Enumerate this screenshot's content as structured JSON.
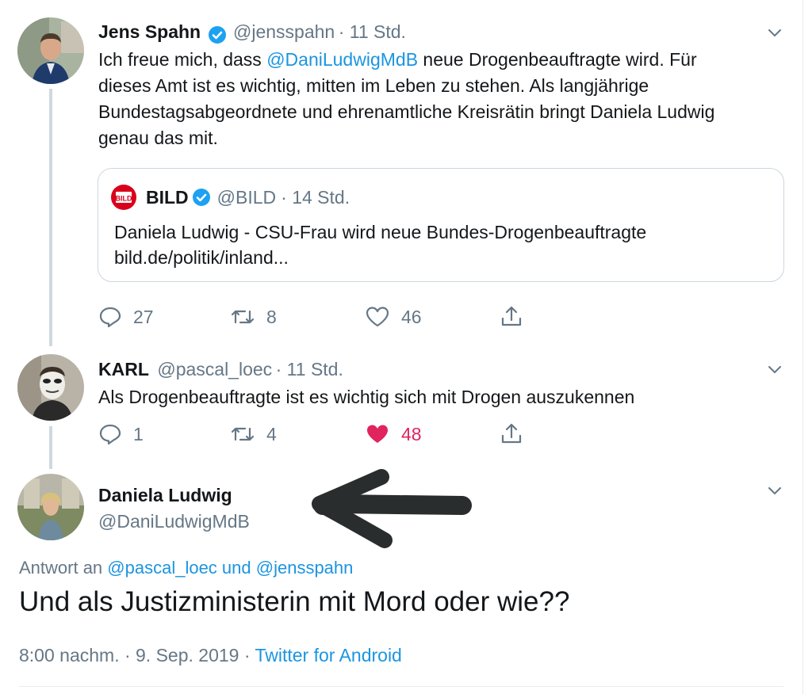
{
  "tweet1": {
    "name": "Jens Spahn",
    "handle": "@jensspahn",
    "time": "· 11 Std.",
    "text_lines": [
      [
        "Ich freue mich, dass ",
        "@DaniLudwigMdB",
        " neue Drogenbeauftragte wird. Für"
      ],
      "dieses Amt ist es wichtig, mitten im Leben zu stehen. Als langjährige",
      "Bundestagsabgeordnete und ehrenamtliche Kreisrätin bringt Daniela Ludwig",
      "genau das mit."
    ],
    "quote": {
      "logo": "BILD",
      "name": "BILD",
      "handle": "@BILD",
      "time": "· 14 Std.",
      "text": "Daniela Ludwig - CSU-Frau wird neue Bundes-Drogenbeauftragte",
      "link": "bild.de/politik/inland..."
    },
    "actions": {
      "replies": "27",
      "retweets": "8",
      "likes": "46"
    }
  },
  "tweet2": {
    "name": "KARL",
    "handle": "@pascal_loec",
    "time": "· 11 Std.",
    "text": "Als Drogenbeauftragte ist es wichtig sich mit Drogen auszukennen",
    "actions": {
      "replies": "1",
      "retweets": "4",
      "likes": "48"
    }
  },
  "tweet3": {
    "name": "Daniela Ludwig",
    "handle": "@DaniLudwigMdB",
    "reply_prefix": "Antwort an ",
    "reply_user1": "@pascal_loec",
    "reply_and": " und ",
    "reply_user2": "@jensspahn",
    "text": "Und als Justizministerin mit Mord oder wie??",
    "timestamp": "8:00 nachm. · 9. Sep. 2019 · ",
    "source": "Twitter for Android"
  },
  "icons": [
    "reply-icon",
    "retweet-icon",
    "like-icon",
    "share-icon",
    "chevron-down-icon",
    "verified-icon",
    "arrow-annotation"
  ],
  "colors": {
    "link": "#1b95e0",
    "like_active": "#e0245e",
    "muted": "#657786",
    "verified": "#1da1f2"
  }
}
